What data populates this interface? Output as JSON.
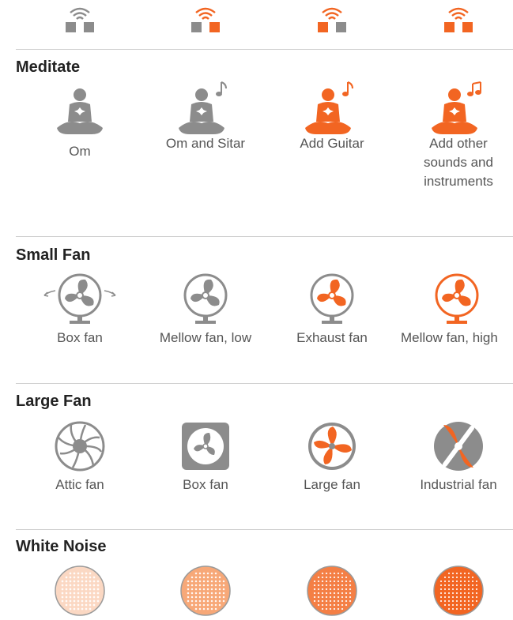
{
  "colors": {
    "gray": "#8c8c8c",
    "light_gray": "#cfcfcf",
    "orange": "#f26522",
    "orange_light": "#f7a070"
  },
  "top_row": {
    "icon": "wifi-speaker-pair-icon",
    "items": [
      {
        "left_square": "gray",
        "right_square": "gray",
        "waves": "gray"
      },
      {
        "left_square": "gray",
        "right_square": "orange",
        "waves": "orange"
      },
      {
        "left_square": "orange",
        "right_square": "gray",
        "waves": "orange"
      },
      {
        "left_square": "orange",
        "right_square": "orange",
        "waves": "orange"
      }
    ]
  },
  "sections": {
    "meditate": {
      "title": "Meditate",
      "items": [
        {
          "label": "Om",
          "icon": "meditation-icon"
        },
        {
          "label": "Om and Sitar",
          "icon": "meditation-note-icon"
        },
        {
          "label": "Add Guitar",
          "icon": "meditation-note-icon"
        },
        {
          "label": "Add other sounds and instruments",
          "icon": "meditation-double-note-icon"
        }
      ]
    },
    "small_fan": {
      "title": "Small Fan",
      "items": [
        {
          "label": "Box fan",
          "icon": "oscillating-fan-icon"
        },
        {
          "label": "Mellow fan, low",
          "icon": "desk-fan-icon"
        },
        {
          "label": "Exhaust fan",
          "icon": "desk-fan-icon"
        },
        {
          "label": "Mellow fan, high",
          "icon": "desk-fan-icon"
        }
      ]
    },
    "large_fan": {
      "title": "Large Fan",
      "items": [
        {
          "label": "Attic fan",
          "icon": "attic-fan-icon"
        },
        {
          "label": "Box fan",
          "icon": "box-fan-icon"
        },
        {
          "label": "Large fan",
          "icon": "large-fan-icon"
        },
        {
          "label": "Industrial fan",
          "icon": "industrial-fan-icon"
        }
      ]
    },
    "white_noise": {
      "title": "White Noise",
      "items": [
        {
          "icon": "white-noise-dots-icon",
          "intensity": 0.25
        },
        {
          "icon": "white-noise-dots-icon",
          "intensity": 0.5
        },
        {
          "icon": "white-noise-dots-icon",
          "intensity": 0.75
        },
        {
          "icon": "white-noise-dots-icon",
          "intensity": 1.0
        }
      ]
    }
  }
}
